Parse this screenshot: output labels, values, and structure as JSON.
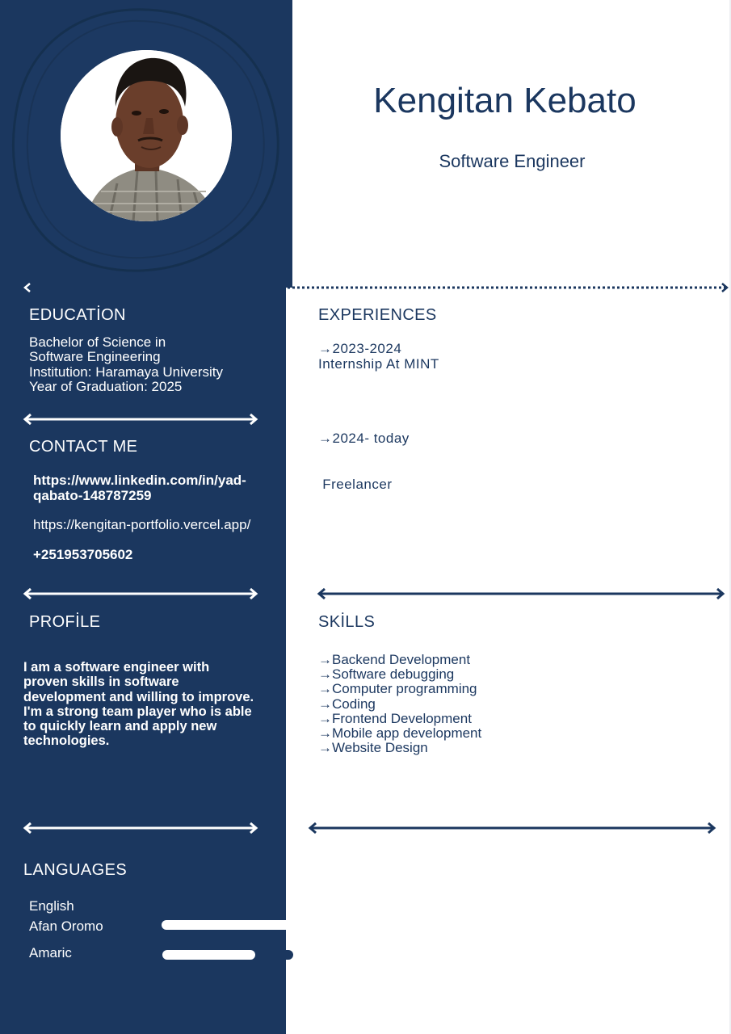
{
  "header": {
    "name": "Kengitan Kebato",
    "title": "Software Engineer"
  },
  "education": {
    "heading": "EDUCATİON",
    "lines": [
      "Bachelor of Science in",
      "Software Engineering",
      "Institution: Haramaya University",
      "Year of Graduation: 2025"
    ]
  },
  "contact": {
    "heading": "CONTACT ME",
    "linkedin": [
      "https://www.linkedin.com/in/yad-",
      "qabato-148787259"
    ],
    "portfolio": "https://kengitan-portfolio.vercel.app/",
    "phone": "+251953705602"
  },
  "profile": {
    "heading": "PROFİLE",
    "lines": [
      "I am a software engineer with",
      "proven skills in software",
      "development and willing to improve.",
      "I'm a strong team player who is able",
      "to quickly learn and apply new",
      "technologies."
    ]
  },
  "languages": {
    "heading": "LANGUAGES",
    "items": [
      {
        "name": "English",
        "level": null
      },
      {
        "name": "Afan Oromo",
        "level": 1.0
      },
      {
        "name": "Amaric",
        "level": 0.7
      }
    ]
  },
  "experiences": {
    "heading": "EXPERIENCES",
    "items": [
      {
        "period": "→2023-2024",
        "role": "Internship At MINT"
      },
      {
        "period": "→2024- today",
        "role": " Freelancer"
      }
    ]
  },
  "skills": {
    "heading": "SKİLLS",
    "items": [
      "→Backend Development",
      "→Software debugging",
      "→Computer programming",
      "→Coding",
      "→Frontend Development",
      "→Mobile app development",
      "→Website Design"
    ]
  },
  "colors": {
    "navy": "#1b375f",
    "white": "#ffffff"
  }
}
